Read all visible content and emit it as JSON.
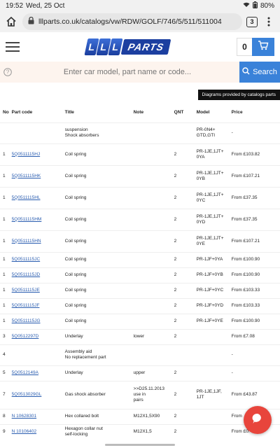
{
  "status": {
    "time": "19:52",
    "date": "Wed, 25 Oct",
    "battery": "80%"
  },
  "browser": {
    "url": "lllparts.co.uk/catalogs/vw/RDW/GOLF/746/5/511/511004",
    "tab_count": "3"
  },
  "site": {
    "logo_lll": "LLL",
    "logo_parts": "PARTS",
    "cart_count": "0"
  },
  "search": {
    "placeholder": "Enter car model, part name or code...",
    "button_label": "Search"
  },
  "provided_by": "Diagrams provided by catalogs parts",
  "table": {
    "headers": {
      "no": "No",
      "part_code": "Part code",
      "title": "Title",
      "note": "Note",
      "qnt": "QNT",
      "model": "Model",
      "price": "Price"
    },
    "rows": [
      {
        "no": "",
        "part_code": "",
        "title": "suspension",
        "title2": "Shock absorbers",
        "note": "",
        "note2": "",
        "note3": "",
        "qnt": "",
        "model": "PR-0N4+",
        "model2": "GTD,GTI",
        "price": "-"
      },
      {
        "no": "1",
        "part_code": "5Q0511115HJ",
        "title": "Coil spring",
        "title2": "",
        "note": "",
        "note2": "",
        "note3": "",
        "qnt": "2",
        "model": "PR-1JE,1JT+",
        "model2": "0YA",
        "price": "From £103.82"
      },
      {
        "no": "1",
        "part_code": "5Q0511115HK",
        "title": "Coil spring",
        "title2": "",
        "note": "",
        "note2": "",
        "note3": "",
        "qnt": "2",
        "model": "PR-1JE,1JT+",
        "model2": "0YB",
        "price": "From £107.21"
      },
      {
        "no": "1",
        "part_code": "5Q0511115HL",
        "title": "Coil spring",
        "title2": "",
        "note": "",
        "note2": "",
        "note3": "",
        "qnt": "2",
        "model": "PR-1JE,1JT+",
        "model2": "0YC",
        "price": "From £37.35"
      },
      {
        "no": "1",
        "part_code": "5Q0511115HM",
        "title": "Coil spring",
        "title2": "",
        "note": "",
        "note2": "",
        "note3": "",
        "qnt": "2",
        "model": "PR-1JE,1JT+",
        "model2": "0YD",
        "price": "From £37.35"
      },
      {
        "no": "1",
        "part_code": "5Q0511115HN",
        "title": "Coil spring",
        "title2": "",
        "note": "",
        "note2": "",
        "note3": "",
        "qnt": "2",
        "model": "PR-1JE,1JT+",
        "model2": "0YE",
        "price": "From £107.21"
      },
      {
        "no": "1",
        "part_code": "5Q0511115JC",
        "title": "Coil spring",
        "title2": "",
        "note": "",
        "note2": "",
        "note3": "",
        "qnt": "2",
        "model": "PR-1JF+0YA",
        "model2": "",
        "price": "From £100.90"
      },
      {
        "no": "1",
        "part_code": "5Q0511115JD",
        "title": "Coil spring",
        "title2": "",
        "note": "",
        "note2": "",
        "note3": "",
        "qnt": "2",
        "model": "PR-1JF+0YB",
        "model2": "",
        "price": "From £100.90"
      },
      {
        "no": "1",
        "part_code": "5Q0511115JE",
        "title": "Coil spring",
        "title2": "",
        "note": "",
        "note2": "",
        "note3": "",
        "qnt": "2",
        "model": "PR-1JF+0YC",
        "model2": "",
        "price": "From £103.33"
      },
      {
        "no": "1",
        "part_code": "5Q0511115JF",
        "title": "Coil spring",
        "title2": "",
        "note": "",
        "note2": "",
        "note3": "",
        "qnt": "2",
        "model": "PR-1JF+0YD",
        "model2": "",
        "price": "From £103.33"
      },
      {
        "no": "1",
        "part_code": "5Q0511115JG",
        "title": "Coil spring",
        "title2": "",
        "note": "",
        "note2": "",
        "note3": "",
        "qnt": "2",
        "model": "PR-1JF+0YE",
        "model2": "",
        "price": "From £100.90"
      },
      {
        "no": "3",
        "part_code": "5Q0512297D",
        "title": "Underlay",
        "title2": "",
        "note": "lower",
        "note2": "",
        "note3": "",
        "qnt": "2",
        "model": "",
        "model2": "",
        "price": "From £7.08"
      },
      {
        "no": "4",
        "part_code": "",
        "title": "Assembly aid",
        "title2": "No replacement part",
        "note": "",
        "note2": "",
        "note3": "",
        "qnt": "",
        "model": "",
        "model2": "",
        "price": "-"
      },
      {
        "no": "5",
        "part_code": "5Q0512149A",
        "title": "Underlay",
        "title2": "",
        "note": "upper",
        "note2": "",
        "note3": "",
        "qnt": "2",
        "model": "",
        "model2": "",
        "price": "-"
      },
      {
        "no": "7",
        "part_code": "5Q0513029GL",
        "title": "Gas shock absorber",
        "title2": "",
        "note": ">>D25.11.2013",
        "note2": "use in",
        "note3": "pairs",
        "qnt": "2",
        "model": "PR-1JE,1JF,",
        "model2": "1JT",
        "price": "From £43.87"
      },
      {
        "no": "8",
        "part_code": "N 10628301",
        "title": "Hex collared bolt",
        "title2": "",
        "note": "M12X1,5X90",
        "note2": "",
        "note3": "",
        "qnt": "2",
        "model": "",
        "model2": "",
        "price": "From"
      },
      {
        "no": "9",
        "part_code": "N 10106402",
        "title": "Hexagon collar nut",
        "title2": "self-locking",
        "note": "M12X1,5",
        "note2": "",
        "note3": "",
        "qnt": "2",
        "model": "",
        "model2": "",
        "price": "From £0."
      }
    ]
  },
  "icons": {
    "home": "home-icon",
    "lock": "lock-icon",
    "menu": "hamburger-icon",
    "cart": "cart-icon",
    "help": "help-icon",
    "search": "search-icon",
    "chat": "chat-icon"
  },
  "colors": {
    "brand_blue": "#1c3fa0",
    "button_blue": "#3a82d9",
    "link": "#2a5db0",
    "chat_red": "#e8453c"
  }
}
